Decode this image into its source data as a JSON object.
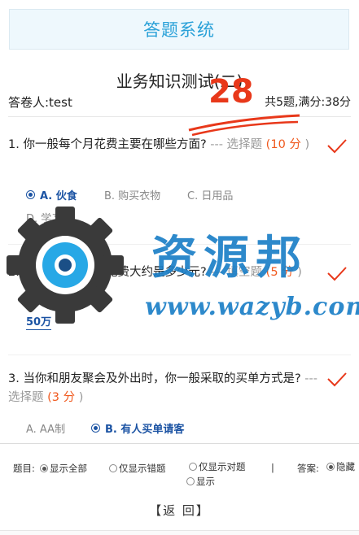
{
  "header": {
    "title": "答题系统"
  },
  "paper": {
    "title": "业务知识测试(二)",
    "examinee": "答卷人:test",
    "summary": "共5题,满分:38分",
    "score": "28"
  },
  "questions": [
    {
      "text": "1. 你一般每个月花费主要在哪些方面?",
      "type": "--- 选择题",
      "score_open": "(",
      "score_num": "10 分",
      "score_close": " )",
      "options": [
        "A. 伙食",
        "B. 购买衣物",
        "C. 日用品",
        "D. 学习"
      ],
      "selected": 0
    },
    {
      "text": "2. 你平均一个月的花费大约是多少元?",
      "type": "--- 填空题",
      "score_open": "(",
      "score_num": "5 分",
      "score_close": " )",
      "answer": "50万"
    },
    {
      "text": "3. 当你和朋友聚会及外出时，你一般采取的买单方式是?",
      "type": "--- 选择题",
      "score_open": "(",
      "score_num": "3 分",
      "score_close": " )",
      "options": [
        "A. AA制",
        "B. 有人买单请客"
      ],
      "selected": 1
    }
  ],
  "filter": {
    "topic_label": "题目:",
    "show_all": "显示全部",
    "show_wrong": "仅显示错题",
    "show_right": "仅显示对题",
    "divider": "|",
    "answer_label": "答案:",
    "hide": "隐藏",
    "show": "显示"
  },
  "back_button": "【返 回】",
  "watermark": {
    "text": "资源邦",
    "url": "www.wazyb.com"
  },
  "colors": {
    "accent": "#2aa1d8",
    "selected": "#1b53a3",
    "score": "#f0591e",
    "check": "#e8381a"
  }
}
